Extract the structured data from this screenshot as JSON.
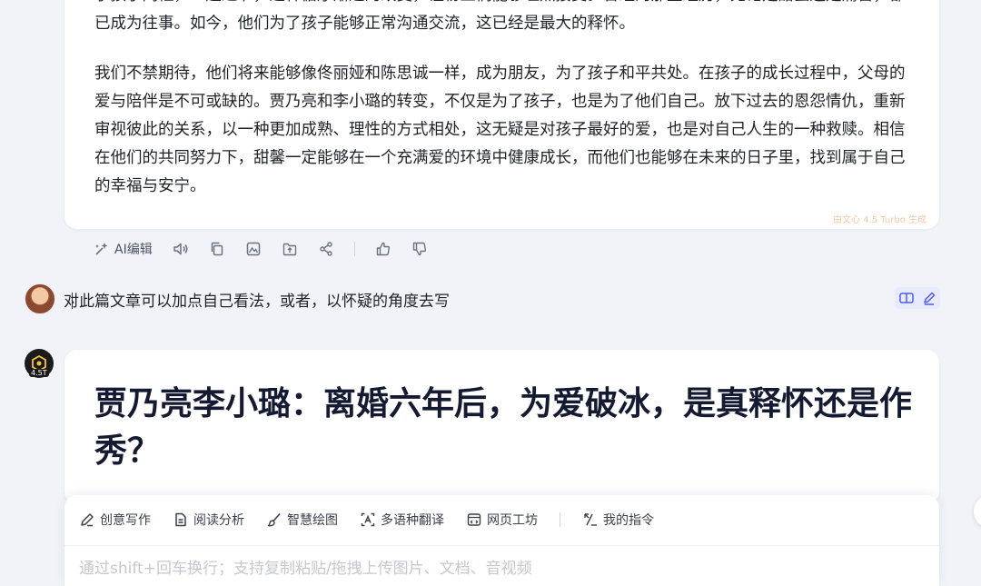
{
  "answer": {
    "paragraphs": [
      "了孩子同框，一起过节，这种循序渐进的改变，让粉丝们能够坦然接受。曾经的那些经历，无论是甜蜜还是痛苦，都已成为往事。如今，他们为了孩子能够正常沟通交流，这已经是最大的释怀。",
      "我们不禁期待，他们将来能够像佟丽娅和陈思诚一样，成为朋友，为了孩子和平共处。在孩子的成长过程中，父母的爱与陪伴是不可或缺的。贾乃亮和李小璐的转变，不仅是为了孩子，也是为了他们自己。放下过去的恩怨情仇，重新审视彼此的关系，以一种更加成熟、理性的方式相处，这无疑是对孩子最好的爱，也是对自己人生的一种救赎。相信在他们的共同努力下，甜馨一定能够在一个充满爱的环境中健康成长，而他们也能够在未来的日子里，找到属于自己的幸福与安宁。"
    ],
    "generated_by": "由文心 4.5 Turbo 生成"
  },
  "actions": {
    "ai_edit_label": "AI编辑",
    "icons": [
      "sparkle-edit-icon",
      "speaker-icon",
      "copy-icon",
      "image-icon",
      "export-icon",
      "share-icon",
      "thumbs-up-icon",
      "thumbs-down-icon"
    ]
  },
  "user_message": {
    "text": "对此篇文章可以加点自己看法，或者，以怀疑的角度去写"
  },
  "bot": {
    "badge": "4.5T",
    "reply_title": "贾乃亮李小璐：离婚六年后，为爱破冰，是真释怀还是作秀？"
  },
  "input": {
    "tools": [
      {
        "label": "创意写作",
        "icon": "pen-icon"
      },
      {
        "label": "阅读分析",
        "icon": "document-icon"
      },
      {
        "label": "智慧绘图",
        "icon": "brush-icon"
      },
      {
        "label": "多语种翻译",
        "icon": "translate-icon"
      },
      {
        "label": "网页工坊",
        "icon": "webpage-icon"
      },
      {
        "label": "我的指令",
        "icon": "command-icon"
      }
    ],
    "placeholder": "通过shift+回车换行；支持复制粘贴/拖拽上传图片、文档、音视频"
  },
  "colors": {
    "accent": "#4b5cf0",
    "page_bg": "#f1f3f9",
    "title": "#151a33"
  }
}
